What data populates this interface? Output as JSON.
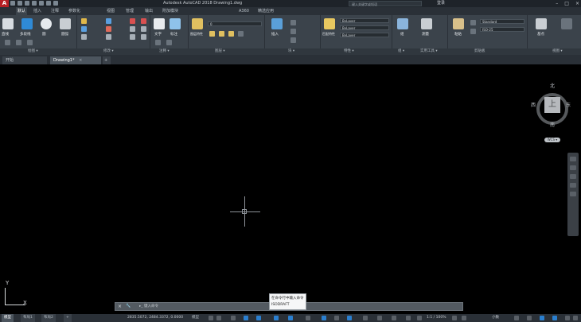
{
  "titlebar": {
    "app_icon": "A",
    "title": "Autodesk AutoCAD 2018    Drawing1.dwg",
    "search_placeholder": "键入关键字或短语",
    "login": "登录",
    "minimize": "–",
    "restore": "□",
    "close": "×"
  },
  "ribbon_tabs": [
    "默认",
    "插入",
    "注释",
    "参数化",
    "视图",
    "管理",
    "输出",
    "附加模块",
    "A360",
    "精选应用"
  ],
  "panel_labels": [
    "绘图 ▾",
    "修改 ▾",
    "注释 ▾",
    "图层 ▾",
    "块 ▾",
    "特性 ▾",
    "组 ▾",
    "实用工具 ▾",
    "剪贴板",
    "视图 ▾"
  ],
  "combos": {
    "layer": "0",
    "color": "ByLayer",
    "linetype": "ByLayer",
    "lineweight": "ByLayer",
    "text_style": "Standard",
    "dim_style": "ISO-25"
  },
  "big_buttons": [
    "直线",
    "多段线",
    "圆",
    "圆弧",
    "文字",
    "标注",
    "图层特性",
    "插入",
    "匹配特性",
    "组",
    "测量",
    "粘贴",
    "基点"
  ],
  "doc_tabs": [
    {
      "label": "开始",
      "active": false
    },
    {
      "label": "Drawing1*",
      "active": true
    }
  ],
  "new_tab_label": "+",
  "viewcube": {
    "top": "上",
    "north": "北",
    "south": "南",
    "east": "东",
    "west": "西",
    "wcs": "WCS ▾"
  },
  "ucs": {
    "x": "X",
    "y": "Y"
  },
  "commandline": {
    "close": "×",
    "settings": "🔧",
    "prompt": "▸_ 键入命令"
  },
  "tooltip": {
    "title": "在命令行中输入命令",
    "command": "ISODRAFT"
  },
  "statusbar": {
    "layout_tabs": [
      "模型",
      "布局1",
      "布局2"
    ],
    "add_layout": "+",
    "coords": "2835.5072, 2484.3372, 0.0000",
    "model": "模型",
    "scale": "1:1 / 100%",
    "units": "小数"
  },
  "colors": {
    "canvas": "#000000",
    "ribbon": "#3b434b",
    "accent": "#1f6fc4",
    "app_icon": "#b51f24"
  }
}
